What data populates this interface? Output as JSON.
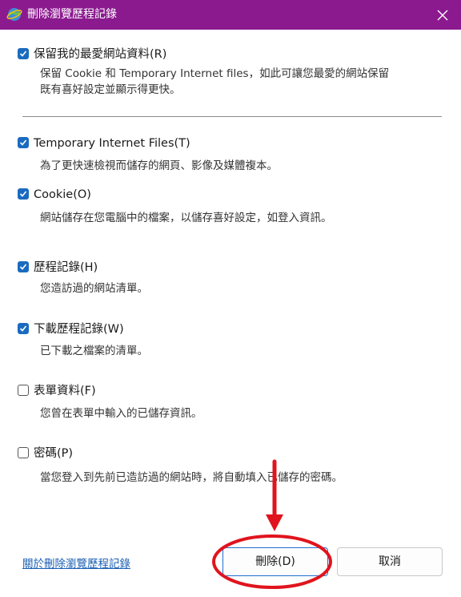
{
  "window": {
    "title": "刪除瀏覽歷程記錄",
    "title_icon": "ie-globe-icon",
    "close_icon": "close-icon"
  },
  "preserve": {
    "label": "保留我的最愛網站資料(R)",
    "checked": true,
    "desc_line1": "保留 Cookie 和 Temporary Internet files，如此可讓您最愛的網站保留",
    "desc_line2": "既有喜好設定並顯示得更快。"
  },
  "options": [
    {
      "label": "Temporary Internet Files(T)",
      "checked": true,
      "desc": "為了更快速檢視而儲存的網頁、影像及媒體複本。"
    },
    {
      "label": "Cookie(O)",
      "checked": true,
      "desc": "網站儲存在您電腦中的檔案，以儲存喜好設定，如登入資訊。"
    },
    {
      "label": "歷程記錄(H)",
      "checked": true,
      "desc": "您造訪過的網站清單。"
    },
    {
      "label": "下載歷程記錄(W)",
      "checked": true,
      "desc": "已下載之檔案的清單。"
    },
    {
      "label": "表單資料(F)",
      "checked": false,
      "desc": "您曾在表單中輸入的已儲存資訊。"
    },
    {
      "label": "密碼(P)",
      "checked": false,
      "desc": "當您登入到先前已造訪過的網站時，將自動填入已儲存的密碼。"
    }
  ],
  "footer": {
    "link": "關於刪除瀏覽歷程記錄",
    "delete_button": "刪除(D)",
    "cancel_button": "取消"
  },
  "annotation": {
    "color": "#e0141e",
    "shapes": [
      "down-arrow",
      "ellipse-highlight"
    ]
  }
}
